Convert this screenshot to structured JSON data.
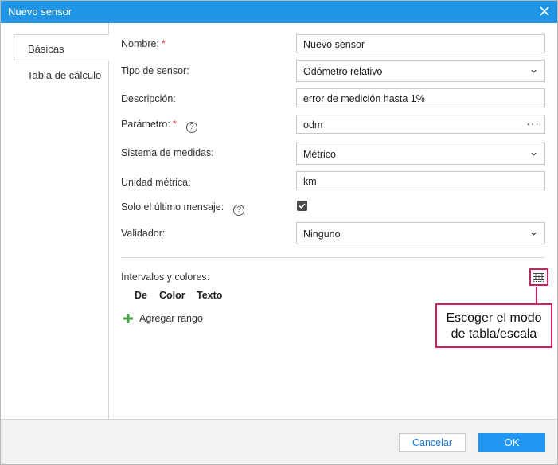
{
  "window": {
    "title": "Nuevo sensor"
  },
  "tabs": [
    {
      "label": "Básicas"
    },
    {
      "label": "Tabla de cálculo"
    }
  ],
  "form": {
    "name": {
      "label": "Nombre:",
      "value": "Nuevo sensor",
      "required_mark": "*"
    },
    "sensor_type": {
      "label": "Tipo de sensor:",
      "value": "Odómetro relativo"
    },
    "description": {
      "label": "Descripción:",
      "value": "error de medición hasta 1%"
    },
    "parameter": {
      "label": "Parámetro:",
      "value": "odm",
      "required_mark": "*",
      "help": "?",
      "more": "···"
    },
    "measurement_system": {
      "label": "Sistema de medidas:",
      "value": "Métrico"
    },
    "metric_unit": {
      "label": "Unidad métrica:",
      "value": "km"
    },
    "last_message_only": {
      "label": "Solo el último mensaje:",
      "checked": true,
      "help": "?"
    },
    "validator": {
      "label": "Validador:",
      "value": "Ninguno"
    }
  },
  "intervals": {
    "label": "Intervalos y colores:",
    "columns": [
      "De",
      "Color",
      "Texto"
    ],
    "add_range_label": "Agregar rango",
    "mode_toggle_icon": "table-scale-icon"
  },
  "callout": {
    "line1": "Escoger el modo",
    "line2": "de tabla/escala",
    "color": "#d81b60"
  },
  "footer": {
    "cancel_label": "Cancelar",
    "ok_label": "OK"
  },
  "colors": {
    "titlebar": "#2196e6",
    "primary": "#2196f3",
    "add": "#43a047",
    "required": "#e53935"
  }
}
